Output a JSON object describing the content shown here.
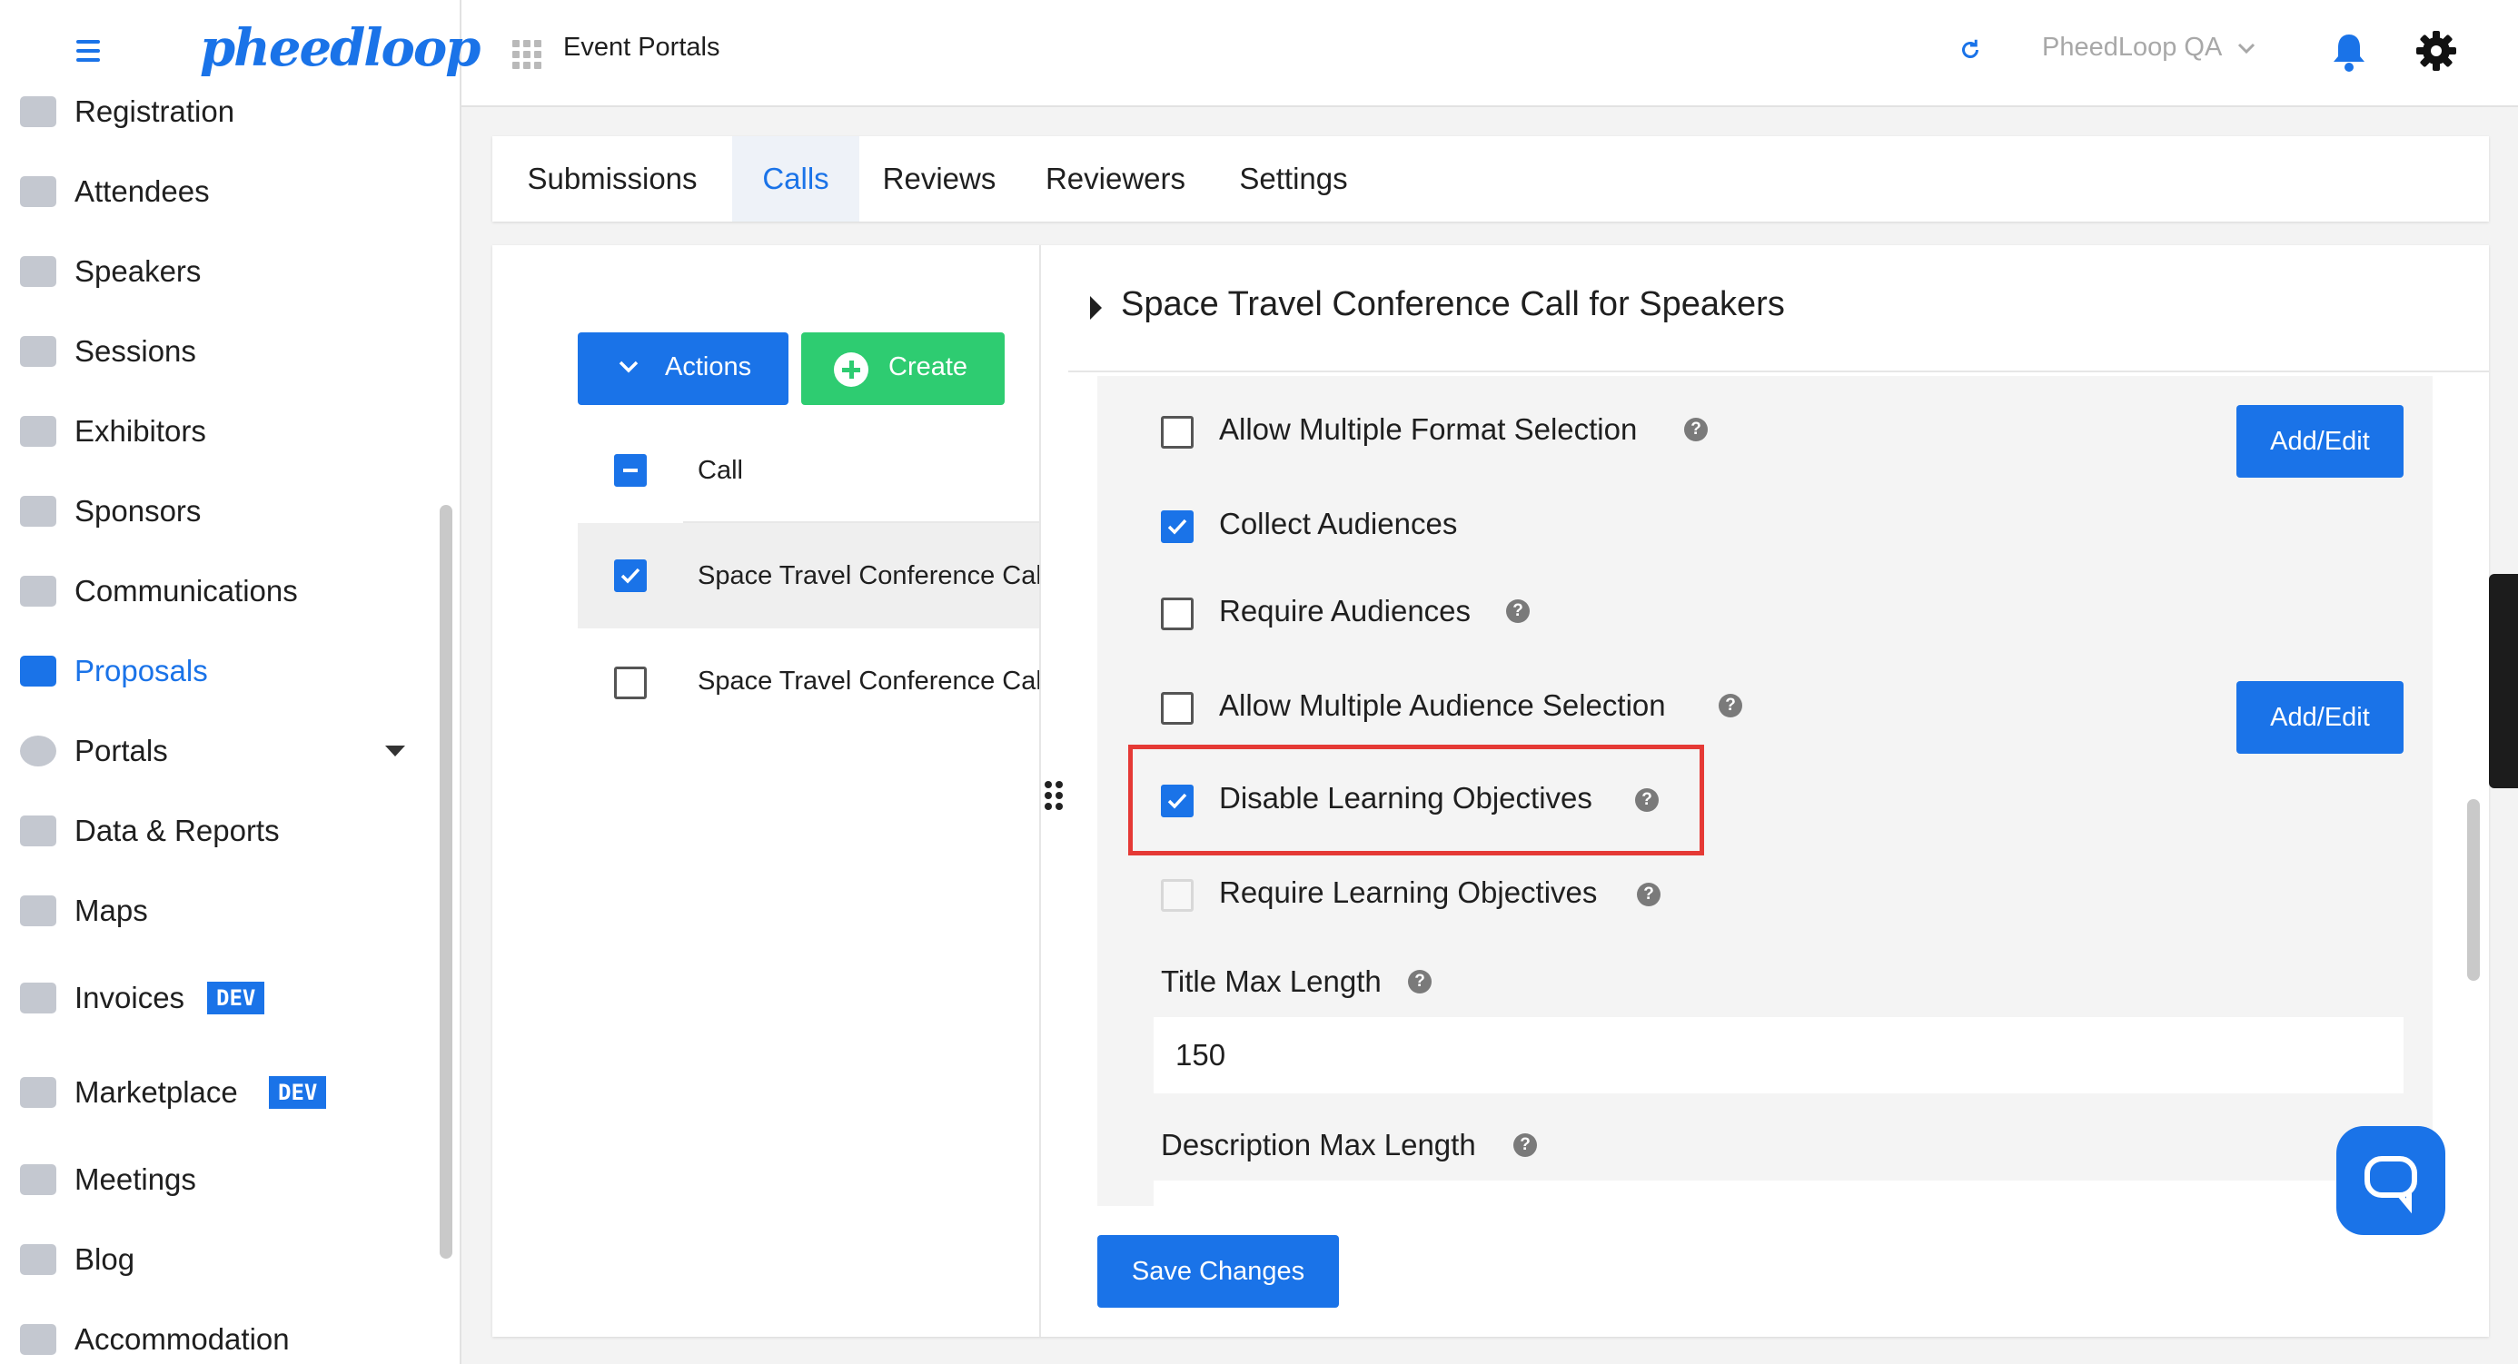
{
  "header": {
    "logo_text": "pheedloop",
    "portal_title": "Event Portals",
    "account_name": "PheedLoop QA"
  },
  "sidebar": {
    "items": [
      {
        "label": "Registration"
      },
      {
        "label": "Attendees"
      },
      {
        "label": "Speakers"
      },
      {
        "label": "Sessions"
      },
      {
        "label": "Exhibitors"
      },
      {
        "label": "Sponsors"
      },
      {
        "label": "Communications"
      },
      {
        "label": "Proposals",
        "active": true
      },
      {
        "label": "Portals"
      },
      {
        "label": "Data & Reports"
      },
      {
        "label": "Maps"
      },
      {
        "label": "Invoices",
        "badge": "DEV"
      },
      {
        "label": "Marketplace",
        "badge": "DEV"
      },
      {
        "label": "Meetings"
      },
      {
        "label": "Blog"
      },
      {
        "label": "Accommodation"
      }
    ]
  },
  "tabs": [
    {
      "label": "Submissions"
    },
    {
      "label": "Calls",
      "active": true
    },
    {
      "label": "Reviews"
    },
    {
      "label": "Reviewers"
    },
    {
      "label": "Settings"
    }
  ],
  "list": {
    "actions_label": "Actions",
    "create_label": "Create",
    "column_header": "Call",
    "rows": [
      {
        "text": "Space Travel Conference Call for Speakers",
        "checked": true
      },
      {
        "text": "Space Travel Conference Call for Speakers",
        "checked": false
      }
    ]
  },
  "panel": {
    "title": "Space Travel Conference Call for Speakers",
    "options": [
      {
        "label": "Allow Multiple Format Selection",
        "checked": false,
        "help": true
      },
      {
        "label": "Collect Audiences",
        "checked": true,
        "help": false
      },
      {
        "label": "Require Audiences",
        "checked": false,
        "help": true
      },
      {
        "label": "Allow Multiple Audience Selection",
        "checked": false,
        "help": true
      },
      {
        "label": "Disable Learning Objectives",
        "checked": true,
        "help": true
      },
      {
        "label": "Require Learning Objectives",
        "checked": false,
        "disabled": true,
        "help": true
      }
    ],
    "add_edit_label": "Add/Edit",
    "title_max_length_label": "Title Max Length",
    "title_max_length_value": "150",
    "description_max_length_label": "Description Max Length",
    "save_label": "Save Changes",
    "help_glyph": "?"
  },
  "colors": {
    "primary": "#1a73e8",
    "create_green": "#2ecc71",
    "highlight_red": "#e53935"
  }
}
